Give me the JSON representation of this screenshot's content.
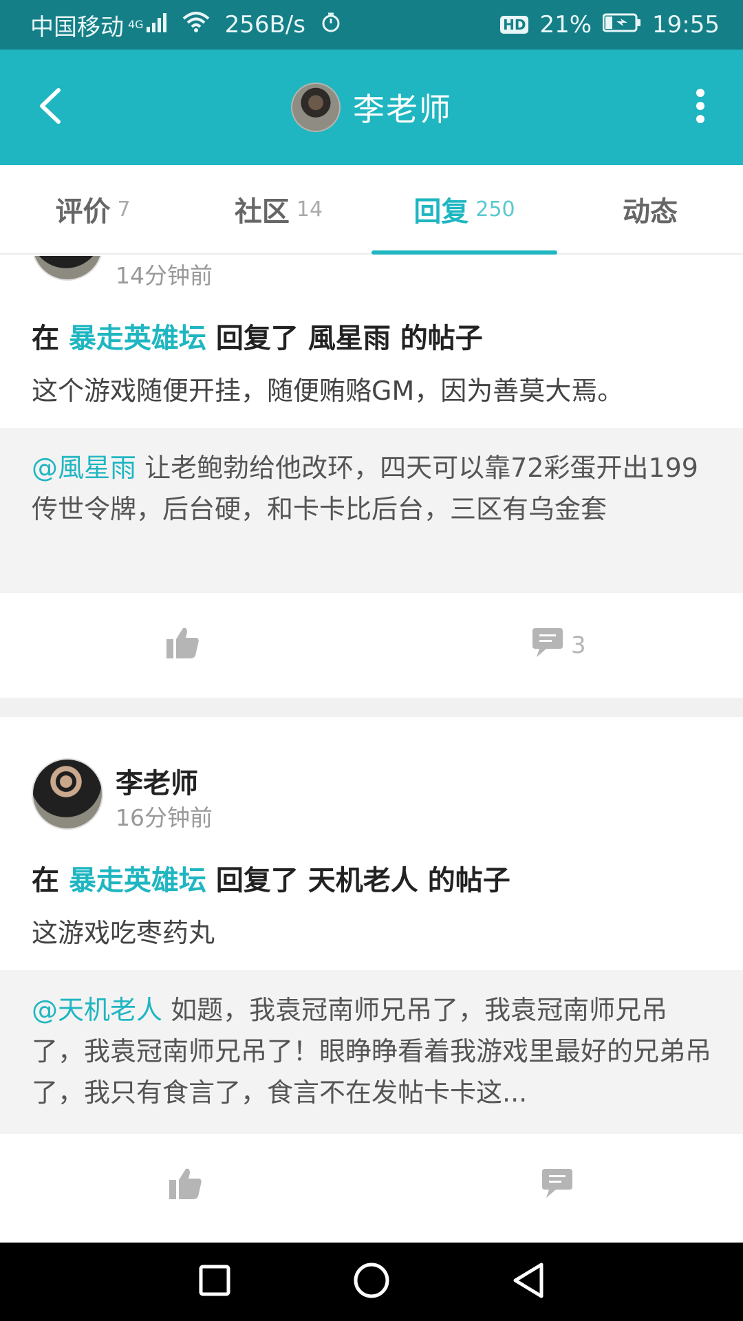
{
  "status_bar": {
    "carrier": "中国移动",
    "network": "4G",
    "speed": "256B/s",
    "hd": "HD",
    "battery": "21%",
    "time": "19:55"
  },
  "header": {
    "title": "李老师"
  },
  "tabs": [
    {
      "label": "评价",
      "count": "7"
    },
    {
      "label": "社区",
      "count": "14"
    },
    {
      "label": "回复",
      "count": "250",
      "active": true
    },
    {
      "label": "动态",
      "count": ""
    }
  ],
  "posts": [
    {
      "author": "",
      "time": "14分钟前",
      "title_prefix": "在",
      "forum": "暴走英雄坛",
      "title_suffix": "回复了 風星雨 的帖子",
      "body": "这个游戏随便开挂，随便贿赂GM，因为善莫大焉。",
      "quote_mention": "@風星雨",
      "quote_text": " 让老鲍勃给他改环，四天可以靠72彩蛋开出199传世令牌，后台硬，和卡卡比后台，三区有乌金套",
      "comment_count": "3"
    },
    {
      "author": "李老师",
      "time": "16分钟前",
      "title_prefix": "在",
      "forum": "暴走英雄坛",
      "title_suffix": "回复了 天机老人 的帖子",
      "body": "这游戏吃枣药丸",
      "quote_mention": "@天机老人",
      "quote_text": " 如题，我袁冠南师兄吊了，我袁冠南师兄吊了，我袁冠南师兄吊了！眼睁睁看着我游戏里最好的兄弟吊了，我只有食言了，食言不在发帖卡卡这...",
      "comment_count": ""
    }
  ],
  "icons": {
    "back": "back-arrow-icon",
    "more": "more-vertical-icon",
    "like": "thumbs-up-icon",
    "comment": "comment-bubble-icon"
  },
  "colors": {
    "accent": "#1fb6c1",
    "status_bar": "#157f87"
  }
}
